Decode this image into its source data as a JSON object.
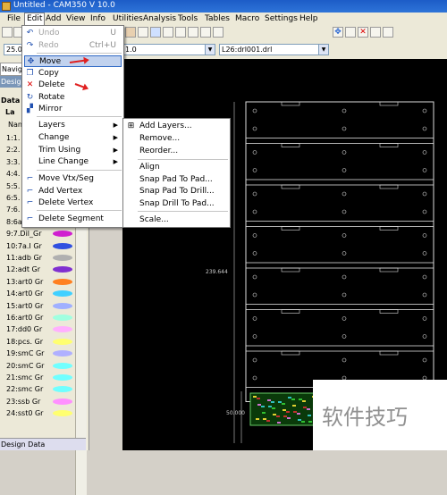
{
  "window": {
    "title": "Untitled - CAM350 V 10.0"
  },
  "menubar": [
    "File",
    "Edit",
    "Add",
    "View",
    "Info",
    "Utilities",
    "Analysis",
    "Tools",
    "Tables",
    "Macro",
    "Settings",
    "Help"
  ],
  "toolbar2": {
    "zoom_value": "25.0",
    "combo_value": "1.0",
    "layer_value": "L26:drl001.drl"
  },
  "left_panel": {
    "tab_navigator": "Navig",
    "tab_design": "Design",
    "header_data": "Data",
    "header_layers": "La",
    "column_name": "Nan",
    "layers": [
      {
        "name": "1:1.",
        "color": "#3aa0ff"
      },
      {
        "name": "2:2.",
        "color": "#3aa0ff"
      },
      {
        "name": "3:3.",
        "color": "#3aa0ff"
      },
      {
        "name": "4:4.",
        "color": "#3aa0ff"
      },
      {
        "name": "5:5.",
        "color": "#3aa0ff"
      },
      {
        "name": "6:5.",
        "color": "#3aa0ff"
      },
      {
        "name": "7:6.",
        "color": "#3aa0ff"
      },
      {
        "name": "8:6a.r Gr",
        "color": "#2ad8c0"
      },
      {
        "name": "9:7.Dil_Gr",
        "color": "#d020d0"
      },
      {
        "name": "10:7a.I Gr",
        "color": "#3050e0"
      },
      {
        "name": "11:adb Gr",
        "color": "#b0b0b0"
      },
      {
        "name": "12:adt Gr",
        "color": "#8030d0"
      },
      {
        "name": "13:art0 Gr",
        "color": "#ff8020"
      },
      {
        "name": "14:art0 Gr",
        "color": "#40d0ff"
      },
      {
        "name": "15:art0 Gr",
        "color": "#a0b0ff"
      },
      {
        "name": "16:art0 Gr",
        "color": "#a0ffe0"
      },
      {
        "name": "17:dd0 Gr",
        "color": "#ffb0ff"
      },
      {
        "name": "18:pcs. Gr",
        "color": "#ffff70"
      },
      {
        "name": "19:smC Gr",
        "color": "#b0b0ff"
      },
      {
        "name": "20:smC Gr",
        "color": "#70ffff"
      },
      {
        "name": "21:smc Gr",
        "color": "#70ffff"
      },
      {
        "name": "22:smc Gr",
        "color": "#70ffff"
      },
      {
        "name": "23:ssb Gr",
        "color": "#ff90ff"
      },
      {
        "name": "24:sst0 Gr",
        "color": "#ffff70"
      }
    ],
    "bottom_tab": "Design Data"
  },
  "edit_menu": {
    "items": [
      {
        "label": "Undo",
        "shortcut": "U",
        "icon": "undo-icon",
        "glyph": "↶",
        "disabled": true
      },
      {
        "label": "Redo",
        "shortcut": "Ctrl+U",
        "icon": "redo-icon",
        "glyph": "↷",
        "disabled": true
      },
      {
        "label": "Move",
        "icon": "move-icon",
        "glyph": "✥",
        "highlighted": true
      },
      {
        "label": "Copy",
        "icon": "copy-icon",
        "glyph": "❐"
      },
      {
        "label": "Delete",
        "icon": "delete-icon",
        "glyph": "✕"
      },
      {
        "label": "Rotate",
        "icon": "rotate-icon",
        "glyph": "↻"
      },
      {
        "label": "Mirror",
        "icon": "mirror-icon",
        "glyph": "▞"
      },
      {
        "label": "Layers",
        "submenu": true
      },
      {
        "label": "Change",
        "submenu": true
      },
      {
        "label": "Trim Using",
        "submenu": true
      },
      {
        "label": "Line Change",
        "submenu": true
      },
      {
        "label": "Move Vtx/Seg",
        "icon": "move-vertex-icon",
        "glyph": "⌐"
      },
      {
        "label": "Add Vertex",
        "icon": "add-vertex-icon",
        "glyph": "⌐"
      },
      {
        "label": "Delete Vertex",
        "icon": "delete-vertex-icon",
        "glyph": "⌐"
      },
      {
        "label": "Delete Segment",
        "icon": "delete-segment-icon",
        "glyph": "⌐"
      }
    ]
  },
  "layers_submenu": {
    "items": [
      {
        "label": "Add Layers...",
        "icon": "add-layers-icon"
      },
      {
        "label": "Remove..."
      },
      {
        "label": "Reorder..."
      },
      {
        "label": "Align"
      },
      {
        "label": "Snap Pad To Pad..."
      },
      {
        "label": "Snap Pad To Drill..."
      },
      {
        "label": "Snap Drill To Pad..."
      },
      {
        "label": "Scale..."
      }
    ]
  },
  "canvas": {
    "dim_label_vertical": "239.644",
    "dim_label_small": "50.000",
    "panel_rows": 7
  },
  "watermark": "软件技巧",
  "colors": {
    "titlebar": "#1c5cc7",
    "menu_highlight": "#c1d2ee",
    "canvas": "#000000",
    "arrow": "#e02020"
  }
}
